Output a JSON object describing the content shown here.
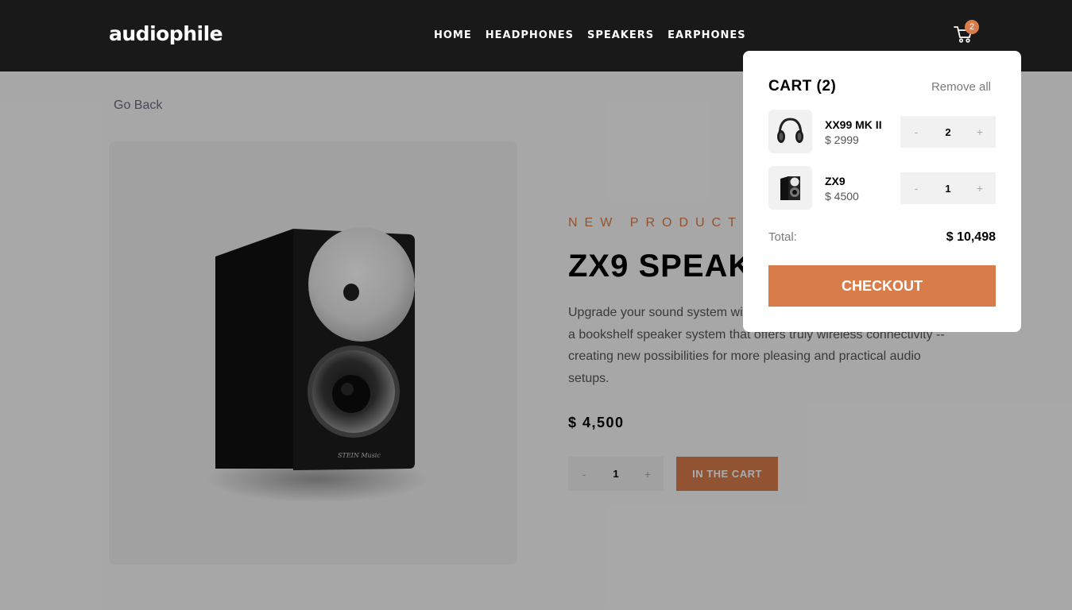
{
  "header": {
    "logo": "audiophile",
    "nav": [
      "HOME",
      "HEADPHONES",
      "SPEAKERS",
      "EARPHONES"
    ],
    "cart_icon": "cart-icon",
    "cart_count": "2"
  },
  "page": {
    "go_back": "Go Back",
    "overline": "NEW PRODUCT",
    "title": "ZX9 SPEAKER",
    "description": "Upgrade your sound system with the all new ZX9 active speaker. It's a bookshelf speaker system that offers truly wireless connectivity -- creating new possibilities for more pleasing and practical audio setups.",
    "price": "$ 4,500",
    "quantity": "1",
    "minus": "-",
    "plus": "+",
    "in_cart_label": "IN THE CART",
    "brand_mark": "STEIN Music"
  },
  "cart": {
    "title": "CART (2)",
    "remove_all": "Remove all",
    "items": [
      {
        "name": "XX99 MK II",
        "price": "$ 2999",
        "quantity": "2",
        "minus": "-",
        "plus": "+"
      },
      {
        "name": "ZX9",
        "price": "$ 4500",
        "quantity": "1",
        "minus": "-",
        "plus": "+"
      }
    ],
    "total_label": "Total:",
    "total_value": "$ 10,498",
    "checkout_label": "CHECKOUT"
  },
  "colors": {
    "accent": "#d87d4a",
    "header_bg": "#191919",
    "overlay": "rgba(0,0,0,0.33)"
  }
}
